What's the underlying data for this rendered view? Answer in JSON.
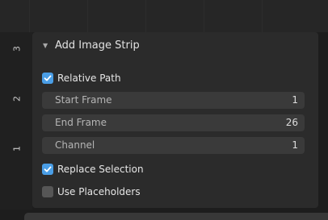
{
  "gutter": {
    "labels": [
      "3",
      "2",
      "1"
    ]
  },
  "panel": {
    "title": "Add Image Strip",
    "relative_path": {
      "label": "Relative Path",
      "checked": true
    },
    "fields": [
      {
        "label": "Start Frame",
        "value": "1"
      },
      {
        "label": "End Frame",
        "value": "26"
      },
      {
        "label": "Channel",
        "value": "1"
      }
    ],
    "replace_selection": {
      "label": "Replace Selection",
      "checked": true
    },
    "use_placeholders": {
      "label": "Use Placeholders",
      "checked": false
    }
  },
  "colors": {
    "accent": "#4a9ee6",
    "panel_bg": "#2b2b2b",
    "field_bg": "#3a3a3a"
  }
}
